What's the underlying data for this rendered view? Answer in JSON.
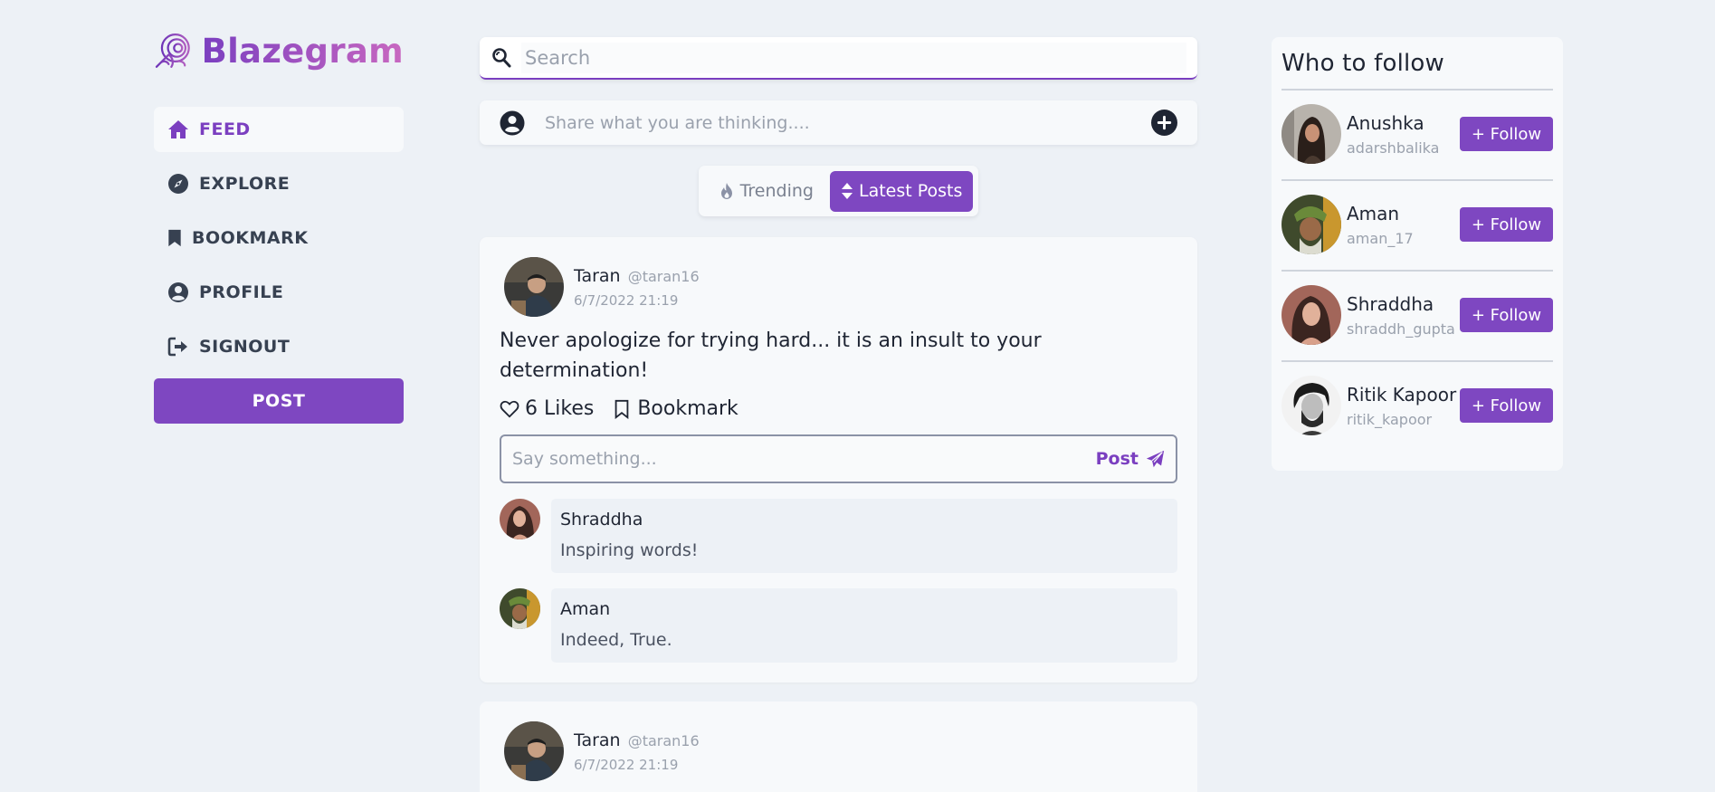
{
  "brand": {
    "name": "Blazegram",
    "accent": "#7e47c1"
  },
  "nav": {
    "items": [
      {
        "label": "FEED",
        "icon": "home-icon"
      },
      {
        "label": "EXPLORE",
        "icon": "compass-icon"
      },
      {
        "label": "BOOKMARK",
        "icon": "bookmark-icon"
      },
      {
        "label": "PROFILE",
        "icon": "user-circle-icon"
      },
      {
        "label": "SIGNOUT",
        "icon": "signout-icon"
      }
    ],
    "post_label": "POST"
  },
  "search": {
    "placeholder": "Search"
  },
  "composer": {
    "placeholder": "Share what you are thinking...."
  },
  "tabs": {
    "trending": "Trending",
    "latest": "Latest Posts"
  },
  "post": {
    "name": "Taran",
    "handle": "@taran16",
    "time": "6/7/2022 21:19",
    "text": "Never apologize for trying hard... it is an insult to your determination!",
    "likes": "6 Likes",
    "bookmark": "Bookmark",
    "comment_placeholder": "Say something...",
    "comment_post": "Post",
    "comments": [
      {
        "name": "Shraddha",
        "text": "Inspiring words!"
      },
      {
        "name": "Aman",
        "text": "Indeed, True."
      }
    ]
  },
  "post2": {
    "name": "Taran",
    "handle": "@taran16",
    "time": "6/7/2022 21:19"
  },
  "who_to_follow": {
    "title": "Who to follow",
    "follow_label": "+ Follow",
    "users": [
      {
        "name": "Anushka",
        "username": "adarshbalika"
      },
      {
        "name": "Aman",
        "username": "aman_17"
      },
      {
        "name": "Shraddha",
        "username": "shraddh_gupta"
      },
      {
        "name": "Ritik Kapoor",
        "username": "ritik_kapoor"
      }
    ]
  }
}
